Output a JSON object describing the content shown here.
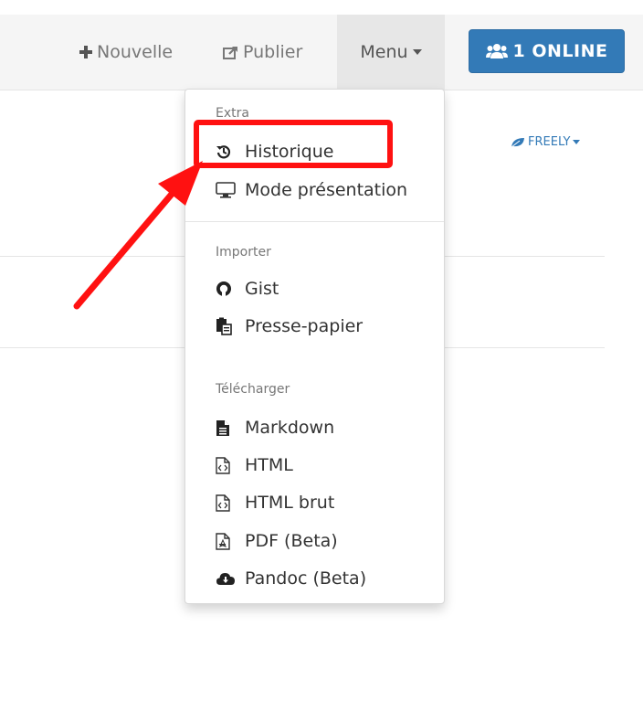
{
  "navbar": {
    "new_label": "Nouvelle",
    "publish_label": "Publier",
    "menu_label": "Menu",
    "online_label": "1 ONLINE"
  },
  "permission": {
    "label": "FREELY"
  },
  "dropdown": {
    "sections": [
      {
        "header": "Extra",
        "items": [
          {
            "label": "Historique",
            "icon": "history-icon"
          },
          {
            "label": "Mode présentation",
            "icon": "desktop-icon"
          }
        ]
      },
      {
        "header": "Importer",
        "items": [
          {
            "label": "Gist",
            "icon": "github-icon"
          },
          {
            "label": "Presse-papier",
            "icon": "paste-icon"
          }
        ]
      },
      {
        "header": "Télécharger",
        "items": [
          {
            "label": "Markdown",
            "icon": "file-text-icon"
          },
          {
            "label": "HTML",
            "icon": "file-code-icon"
          },
          {
            "label": "HTML brut",
            "icon": "file-code-icon"
          },
          {
            "label": "PDF (Beta)",
            "icon": "file-pdf-icon"
          },
          {
            "label": "Pandoc (Beta)",
            "icon": "cloud-download-icon"
          }
        ]
      }
    ]
  },
  "colors": {
    "accent": "#337ab7",
    "highlight": "#ff1111",
    "navbar_bg": "#f5f5f5"
  }
}
